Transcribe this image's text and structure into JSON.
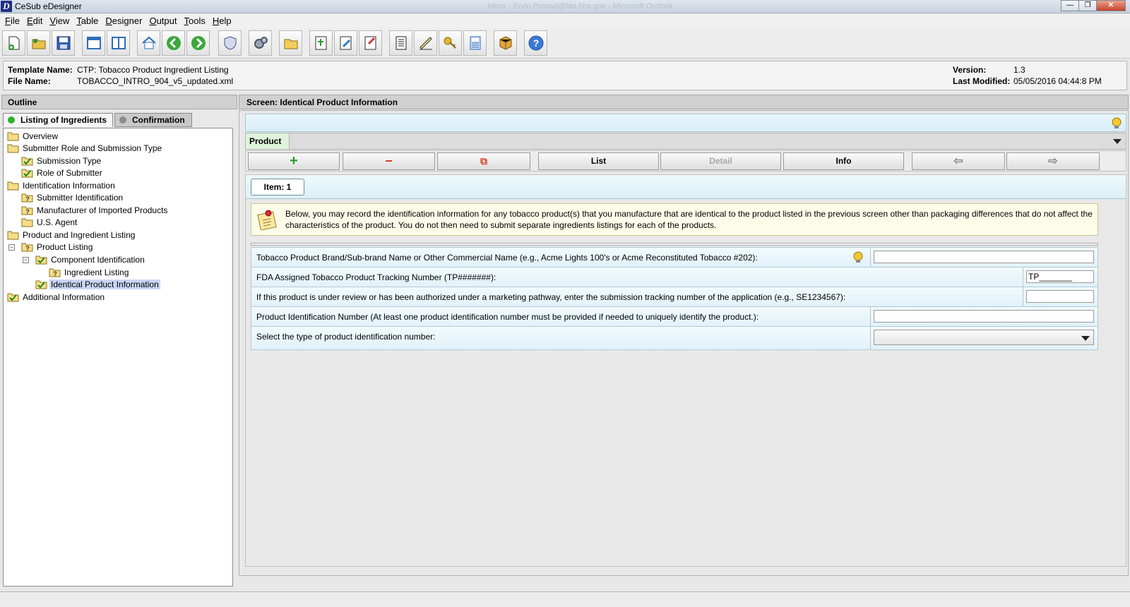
{
  "window": {
    "title": "CeSub eDesigner",
    "faded_title": "Inbox - Ervin.Prosad@fda.hhs.gov - Microsoft Outlook",
    "minimize": "—",
    "maximize": "❐",
    "close": "✕"
  },
  "menu": [
    {
      "u": "F",
      "rest": "ile"
    },
    {
      "u": "E",
      "rest": "dit"
    },
    {
      "u": "V",
      "rest": "iew"
    },
    {
      "u": "T",
      "rest": "able"
    },
    {
      "u": "D",
      "rest": "esigner"
    },
    {
      "u": "O",
      "rest": "utput"
    },
    {
      "u": "T",
      "rest": "ools"
    },
    {
      "u": "H",
      "rest": "elp"
    }
  ],
  "template_info": {
    "template_name_label": "Template Name:",
    "template_name": "CTP: Tobacco Product Ingredient Listing",
    "file_name_label": "File Name:",
    "file_name": "TOBACCO_INTRO_904_v5_updated.xml",
    "version_label": "Version:",
    "version": "1.3",
    "last_modified_label": "Last Modified:",
    "last_modified": "05/05/2016 04:44:8 PM"
  },
  "outline": {
    "header": "Outline",
    "tabs": [
      {
        "label": "Listing of Ingredients",
        "dot_color": "#2fb12f"
      },
      {
        "label": "Confirmation",
        "dot_color": "#8c8c8c"
      }
    ],
    "tree": [
      {
        "label": "Overview",
        "icon": "folder-icon"
      },
      {
        "label": "Submitter Role and Submission Type",
        "icon": "folder-icon"
      },
      {
        "label": "Submission Type",
        "icon": "checked-folder-icon"
      },
      {
        "label": "Role of Submitter",
        "icon": "checked-folder-icon"
      },
      {
        "label": "Identification Information",
        "icon": "folder-icon"
      },
      {
        "label": "Submitter Identification",
        "icon": "question-folder-icon"
      },
      {
        "label": "Manufacturer of Imported Products",
        "icon": "question-folder-icon"
      },
      {
        "label": "U.S. Agent",
        "icon": "folder-icon"
      },
      {
        "label": "Product and Ingredient Listing",
        "icon": "folder-icon"
      },
      {
        "label": "Product Listing",
        "icon": "question-folder-icon"
      },
      {
        "label": "Component Identification",
        "icon": "checked-folder-icon"
      },
      {
        "label": "Ingredient Listing",
        "icon": "question-folder-icon"
      },
      {
        "label": "Identical Product Information",
        "icon": "checked-folder-icon"
      },
      {
        "label": "Additional Information",
        "icon": "checked-folder-icon"
      }
    ]
  },
  "screen": {
    "header": "Screen: Identical Product Information",
    "product_label": "Product",
    "product_value": "",
    "buttons": {
      "add": "+",
      "remove": "−",
      "copy": "⧉",
      "list": "List",
      "detail": "Detail",
      "info": "Info",
      "prev": "⇦",
      "next": "⇨"
    },
    "item_tab": "Item: 1",
    "note": "Below, you may record the identification information for any tobacco product(s) that you manufacture that are identical to the product listed in the previous screen other than packaging differences that do not affect the characteristics of the product. You do not then need to submit separate ingredients listings for each of the products.",
    "fields": [
      {
        "label": "Tobacco Product Brand/Sub-brand Name or Other Commercial Name (e.g., Acme Lights 100's or Acme Reconstituted Tobacco #202):",
        "value": ""
      },
      {
        "label": "FDA Assigned Tobacco Product Tracking Number (TP#######):",
        "value": "TP_______"
      },
      {
        "label": "If this product is under review or has been authorized under a marketing pathway, enter the submission tracking number of the application (e.g., SE1234567):",
        "value": ""
      },
      {
        "label": "Product Identification Number (At least one product identification number must be provided if needed to uniquely identify the product.):",
        "value": ""
      },
      {
        "label": "Select the type of product identification number:",
        "value": ""
      }
    ]
  },
  "colors": {
    "hint_bg": "#e3f3f9",
    "product_label_bg": "#dff3dc",
    "note_bg": "#fdfce8",
    "selection": "#c9d6f5"
  }
}
